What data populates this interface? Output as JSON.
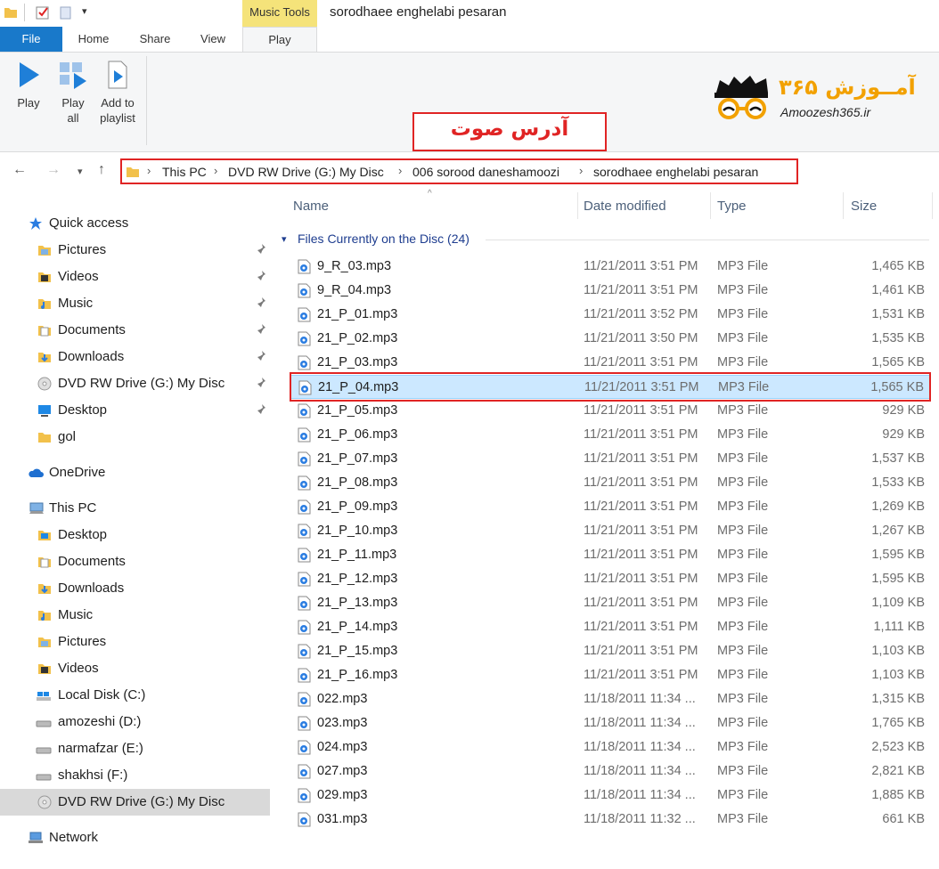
{
  "window": {
    "title": "sorodhaee enghelabi pesaran",
    "context_tab": "Music Tools"
  },
  "ribbon_tabs": [
    "File",
    "Home",
    "Share",
    "View",
    "Play"
  ],
  "ribbon_buttons": {
    "play": {
      "label": "Play"
    },
    "play_all": {
      "label1": "Play",
      "label2": "all"
    },
    "add_to_playlist": {
      "label1": "Add to",
      "label2": "playlist"
    }
  },
  "logo": {
    "persian": "آمــوزش ۳۶۵",
    "english": "Amoozesh365.ir"
  },
  "annotation": {
    "text": "آدرس صوت",
    "color": "#e02424"
  },
  "breadcrumb": [
    "This PC",
    "DVD RW Drive (G:) My Disc",
    "006 sorood daneshamoozi",
    "sorodhaee enghelabi pesaran"
  ],
  "sidebar": {
    "quick_access": {
      "label": "Quick access",
      "items": [
        "Pictures",
        "Videos",
        "Music",
        "Documents",
        "Downloads",
        "DVD RW Drive (G:) My Disc",
        "Desktop",
        "gol"
      ]
    },
    "onedrive": "OneDrive",
    "this_pc": {
      "label": "This PC",
      "items": [
        "Desktop",
        "Documents",
        "Downloads",
        "Music",
        "Pictures",
        "Videos",
        "Local Disk (C:)",
        "amozeshi (D:)",
        "narmafzar (E:)",
        "shakhsi (F:)",
        "DVD RW Drive (G:) My Disc"
      ]
    },
    "network": "Network"
  },
  "columns": {
    "name": "Name",
    "date": "Date modified",
    "type": "Type",
    "size": "Size"
  },
  "group": {
    "title": "Files Currently on the Disc (24)"
  },
  "files": [
    {
      "name": "9_R_03.mp3",
      "date": "11/21/2011 3:51 PM",
      "type": "MP3 File",
      "size": "1,465 KB"
    },
    {
      "name": "9_R_04.mp3",
      "date": "11/21/2011 3:51 PM",
      "type": "MP3 File",
      "size": "1,461 KB"
    },
    {
      "name": "21_P_01.mp3",
      "date": "11/21/2011 3:52 PM",
      "type": "MP3 File",
      "size": "1,531 KB"
    },
    {
      "name": "21_P_02.mp3",
      "date": "11/21/2011 3:50 PM",
      "type": "MP3 File",
      "size": "1,535 KB"
    },
    {
      "name": "21_P_03.mp3",
      "date": "11/21/2011 3:51 PM",
      "type": "MP3 File",
      "size": "1,565 KB"
    },
    {
      "name": "21_P_04.mp3",
      "date": "11/21/2011 3:51 PM",
      "type": "MP3 File",
      "size": "1,565 KB"
    },
    {
      "name": "21_P_05.mp3",
      "date": "11/21/2011 3:51 PM",
      "type": "MP3 File",
      "size": "929 KB"
    },
    {
      "name": "21_P_06.mp3",
      "date": "11/21/2011 3:51 PM",
      "type": "MP3 File",
      "size": "929 KB"
    },
    {
      "name": "21_P_07.mp3",
      "date": "11/21/2011 3:51 PM",
      "type": "MP3 File",
      "size": "1,537 KB"
    },
    {
      "name": "21_P_08.mp3",
      "date": "11/21/2011 3:51 PM",
      "type": "MP3 File",
      "size": "1,533 KB"
    },
    {
      "name": "21_P_09.mp3",
      "date": "11/21/2011 3:51 PM",
      "type": "MP3 File",
      "size": "1,269 KB"
    },
    {
      "name": "21_P_10.mp3",
      "date": "11/21/2011 3:51 PM",
      "type": "MP3 File",
      "size": "1,267 KB"
    },
    {
      "name": "21_P_11.mp3",
      "date": "11/21/2011 3:51 PM",
      "type": "MP3 File",
      "size": "1,595 KB"
    },
    {
      "name": "21_P_12.mp3",
      "date": "11/21/2011 3:51 PM",
      "type": "MP3 File",
      "size": "1,595 KB"
    },
    {
      "name": "21_P_13.mp3",
      "date": "11/21/2011 3:51 PM",
      "type": "MP3 File",
      "size": "1,109 KB"
    },
    {
      "name": "21_P_14.mp3",
      "date": "11/21/2011 3:51 PM",
      "type": "MP3 File",
      "size": "1,111 KB"
    },
    {
      "name": "21_P_15.mp3",
      "date": "11/21/2011 3:51 PM",
      "type": "MP3 File",
      "size": "1,103 KB"
    },
    {
      "name": "21_P_16.mp3",
      "date": "11/21/2011 3:51 PM",
      "type": "MP3 File",
      "size": "1,103 KB"
    },
    {
      "name": "022.mp3",
      "date": "11/18/2011 11:34 ...",
      "type": "MP3 File",
      "size": "1,315 KB"
    },
    {
      "name": "023.mp3",
      "date": "11/18/2011 11:34 ...",
      "type": "MP3 File",
      "size": "1,765 KB"
    },
    {
      "name": "024.mp3",
      "date": "11/18/2011 11:34 ...",
      "type": "MP3 File",
      "size": "2,523 KB"
    },
    {
      "name": "027.mp3",
      "date": "11/18/2011 11:34 ...",
      "type": "MP3 File",
      "size": "2,821 KB"
    },
    {
      "name": "029.mp3",
      "date": "11/18/2011 11:34 ...",
      "type": "MP3 File",
      "size": "1,885 KB"
    },
    {
      "name": "031.mp3",
      "date": "11/18/2011 11:32 ...",
      "type": "MP3 File",
      "size": "661 KB"
    }
  ],
  "selected_file_index": 5,
  "colors": {
    "accent": "#1979ca",
    "selection": "#cce8ff",
    "highlight_red": "#e02424",
    "logo_orange": "#f2a100"
  }
}
